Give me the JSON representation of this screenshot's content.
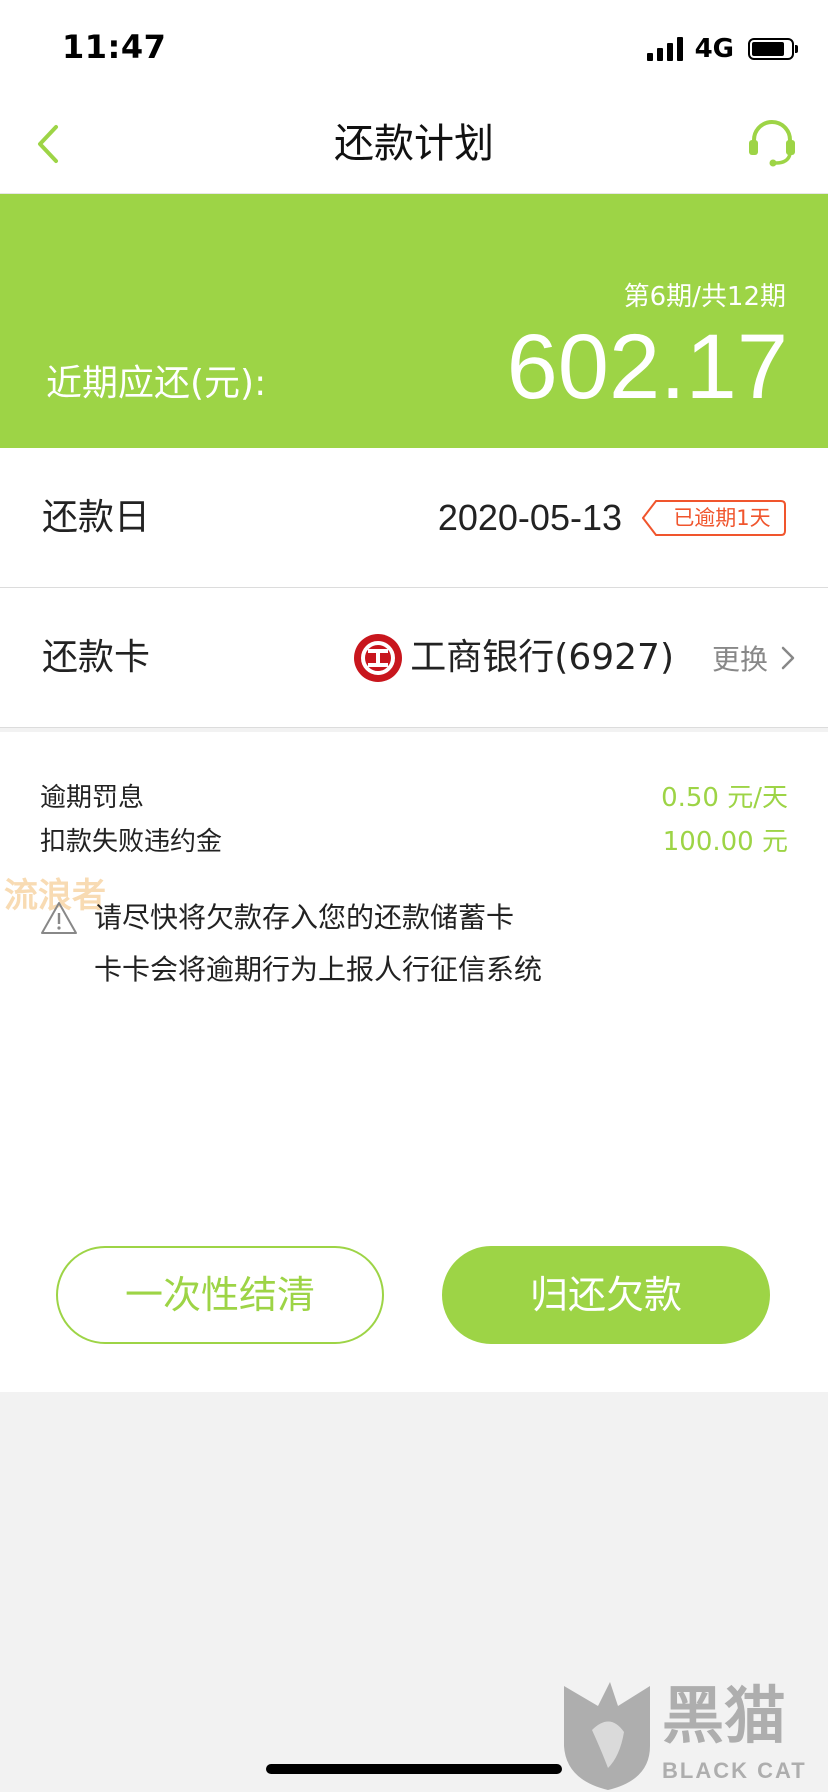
{
  "status_bar": {
    "time": "11:47",
    "network": "4G"
  },
  "nav": {
    "title": "还款计划",
    "back_icon": "chevron-left-icon",
    "service_icon": "headset-icon"
  },
  "summary": {
    "period": "第6期/共12期",
    "due_label": "近期应还(元):",
    "due_amount": "602.17"
  },
  "repay_date": {
    "label": "还款日",
    "value": "2020-05-13",
    "badge": "已逾期1天"
  },
  "repay_card": {
    "label": "还款卡",
    "bank": "工商银行(6927)",
    "change_label": "更换"
  },
  "fees": [
    {
      "label": "逾期罚息",
      "value": "0.50 元/天"
    },
    {
      "label": "扣款失败违约金",
      "value": "100.00 元"
    }
  ],
  "notice": {
    "lines": [
      "请尽快将欠款存入您的还款储蓄卡",
      "卡卡会将逾期行为上报人行征信系统"
    ]
  },
  "watermark": "流浪者",
  "actions": {
    "settle_label": "一次性结清",
    "repay_label": "归还欠款"
  },
  "brand": {
    "name": "黑猫",
    "sub": "BLACK CAT"
  },
  "colors": {
    "primary_green": "#9dd446",
    "overdue_orange": "#f0552d",
    "bank_red": "#c8161d"
  }
}
